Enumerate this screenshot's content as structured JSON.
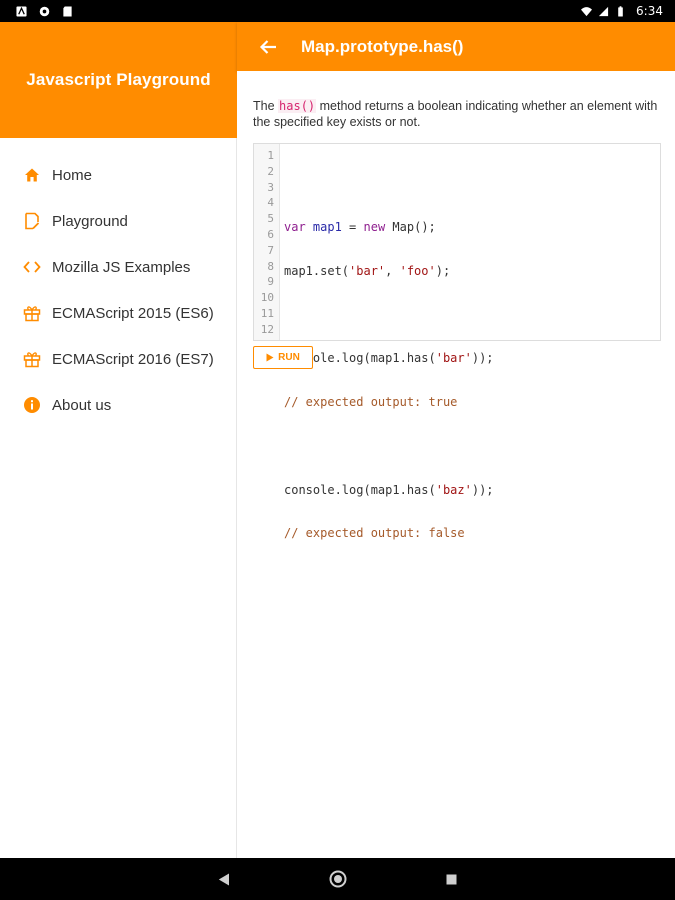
{
  "status_bar": {
    "time": "6:34",
    "icons": [
      "notification-a-icon",
      "circle-icon",
      "sd-card-icon",
      "wifi-icon",
      "signal-icon",
      "battery-icon"
    ]
  },
  "drawer": {
    "title": "Javascript Playground",
    "items": [
      {
        "label": "Home",
        "icon": "home-icon"
      },
      {
        "label": "Playground",
        "icon": "edit-note-icon"
      },
      {
        "label": "Mozilla JS Examples",
        "icon": "code-icon"
      },
      {
        "label": "ECMAScript 2015 (ES6)",
        "icon": "gift-box-icon"
      },
      {
        "label": "ECMAScript 2016 (ES7)",
        "icon": "gift-box-icon"
      },
      {
        "label": "About us",
        "icon": "info-icon"
      }
    ]
  },
  "app_bar": {
    "title": "Map.prototype.has()",
    "back_icon": "arrow-back-icon"
  },
  "description": {
    "before": "The ",
    "keyword": "has()",
    "after": " method returns a boolean indicating whether an element with the specified key exists or not."
  },
  "editor": {
    "line_numbers": [
      "1",
      "2",
      "3",
      "4",
      "5",
      "6",
      "7",
      "8",
      "9",
      "10",
      "11",
      "12"
    ],
    "lines": [
      "",
      "var map1 = new Map();",
      "map1.set('bar', 'foo');",
      "",
      "console.log(map1.has('bar'));",
      "// expected output: true",
      "",
      "console.log(map1.has('baz'));",
      "// expected output: false",
      "",
      "",
      ""
    ]
  },
  "run_button": {
    "label": "RUN",
    "icon": "play-icon"
  },
  "colors": {
    "accent": "#ff8c00",
    "text": "#333333",
    "keyword_highlight": "#d6246e"
  },
  "nav_bar": {
    "icons": [
      "back-triangle-icon",
      "home-circle-icon",
      "recents-square-icon"
    ]
  }
}
